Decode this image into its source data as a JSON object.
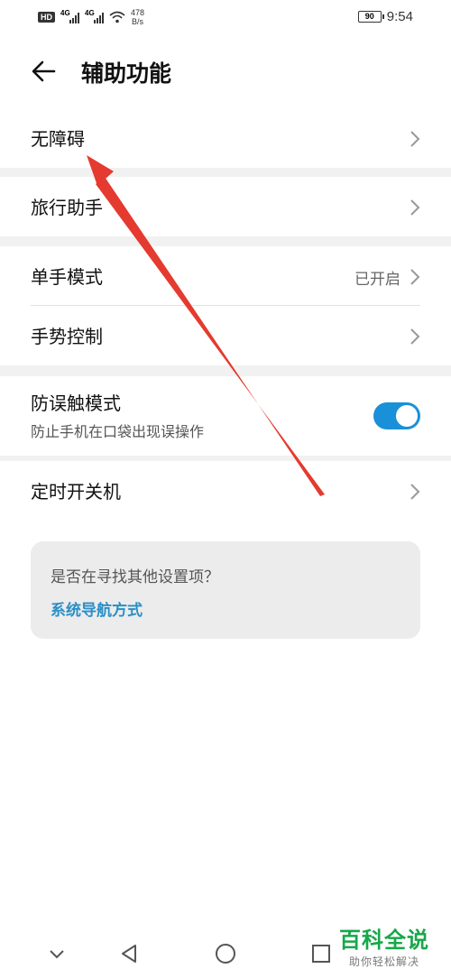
{
  "status_bar": {
    "hd": "HD",
    "sim1_type": "4G",
    "sim2_type": "4G",
    "net_speed_value": "478",
    "net_speed_unit": "B/s",
    "battery": "90",
    "time": "9:54"
  },
  "header": {
    "title": "辅助功能",
    "back_icon": "arrow-left-icon"
  },
  "settings": {
    "accessibility": "无障碍",
    "travel_assistant": "旅行助手",
    "one_hand_mode": {
      "label": "单手模式",
      "value": "已开启"
    },
    "gesture_control": "手势控制",
    "anti_mistouch": {
      "label": "防误触模式",
      "description": "防止手机在口袋出现误操作",
      "enabled": true
    },
    "scheduled_power": "定时开关机"
  },
  "suggestion": {
    "question": "是否在寻找其他设置项？",
    "link": "系统导航方式"
  },
  "watermark": {
    "title": "百科全说",
    "subtitle": "助你轻松解决"
  },
  "colors": {
    "toggle_on": "#1a90d8",
    "link": "#2a8fc7",
    "annotation_arrow": "#e53a2f",
    "watermark": "#18a74a"
  }
}
